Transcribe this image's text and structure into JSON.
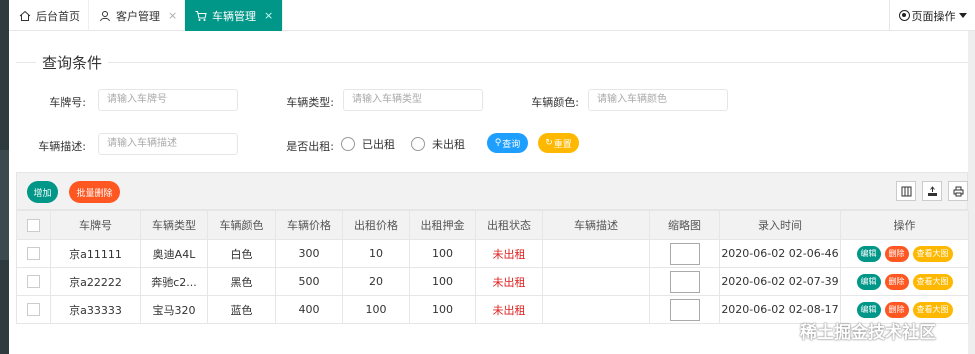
{
  "tabs": [
    {
      "label": "后台首页",
      "icon": "home-icon",
      "closable": false,
      "active": false
    },
    {
      "label": "客户管理",
      "icon": "user-icon",
      "closable": true,
      "active": false
    },
    {
      "label": "车辆管理",
      "icon": "cart-icon",
      "closable": true,
      "active": true
    }
  ],
  "tab_close": "×",
  "page_ops": {
    "label": "页面操作"
  },
  "query": {
    "legend": "查询条件",
    "plate_label": "车牌号:",
    "plate_placeholder": "请输入车牌号",
    "type_label": "车辆类型:",
    "type_placeholder": "请输入车辆类型",
    "color_label": "车辆颜色:",
    "color_placeholder": "请输入车辆颜色",
    "desc_label": "车辆描述:",
    "desc_placeholder": "请输入车辆描述",
    "rented_label": "是否出租:",
    "radio_rented": "已出租",
    "radio_unrented": "未出租",
    "search_btn": "查询",
    "reset_btn": "重置"
  },
  "toolbar": {
    "add": "增加",
    "batch_delete": "批量删除"
  },
  "table": {
    "headers": [
      "车牌号",
      "车辆类型",
      "车辆颜色",
      "车辆价格",
      "出租价格",
      "出租押金",
      "出租状态",
      "车辆描述",
      "缩略图",
      "录入时间",
      "操作"
    ],
    "rows": [
      {
        "plate": "京a11111",
        "type": "奥迪A4L",
        "color": "白色",
        "price": "300",
        "rent": "10",
        "deposit": "100",
        "status": "未出租",
        "desc": "",
        "time": "2020-06-02 02-06-46"
      },
      {
        "plate": "京a22222",
        "type": "奔驰c2...",
        "color": "黑色",
        "price": "500",
        "rent": "20",
        "deposit": "100",
        "status": "未出租",
        "desc": "",
        "time": "2020-06-02 02-07-39"
      },
      {
        "plate": "京a33333",
        "type": "宝马320",
        "color": "蓝色",
        "price": "400",
        "rent": "100",
        "deposit": "100",
        "status": "未出租",
        "desc": "",
        "time": "2020-06-02 02-08-17"
      }
    ],
    "ops": {
      "edit": "编辑",
      "delete": "删除",
      "view": "查看大图"
    }
  },
  "watermark": "稀土掘金技术社区",
  "colors": {
    "primary": "#009688",
    "danger": "#ff5722",
    "normal": "#1e9fff",
    "warm": "#ffb800",
    "status_red": "#e02020"
  }
}
